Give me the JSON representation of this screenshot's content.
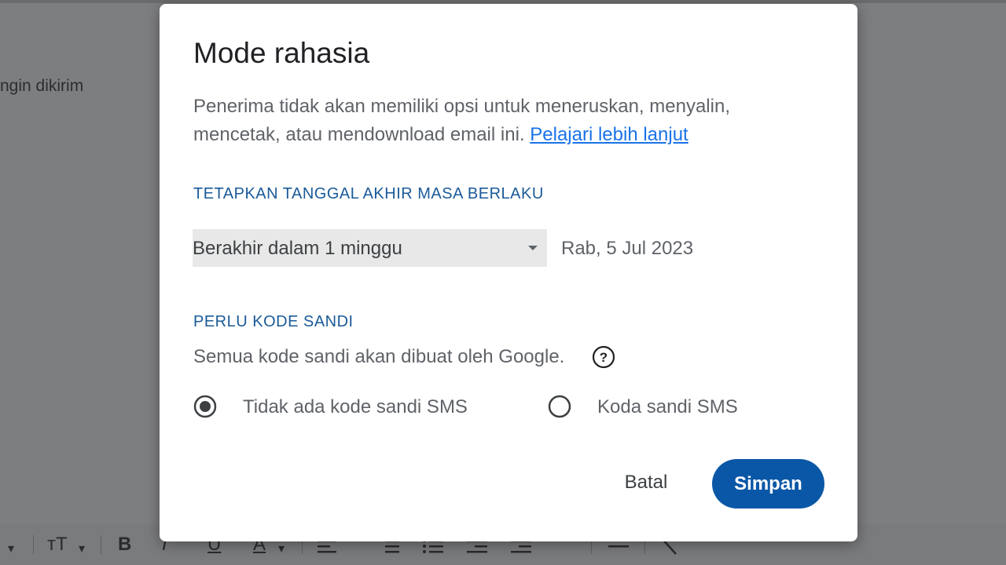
{
  "background": {
    "compose_text": "ngin dikirim",
    "toolbar": {
      "font_size_label": "тT",
      "bold": "B",
      "italic": "I",
      "underline": "U",
      "text_color": "A",
      "quote": "❞"
    }
  },
  "dialog": {
    "title": "Mode rahasia",
    "description": "Penerima tidak akan memiliki opsi untuk meneruskan, menyalin, mencetak, atau mendownload email ini.",
    "learn_more": "Pelajari lebih lanjut",
    "expiry": {
      "label": "TETAPKAN TANGGAL AKHIR MASA BERLAKU",
      "selected": "Berakhir dalam 1 minggu",
      "date": "Rab, 5 Jul 2023"
    },
    "passcode": {
      "label": "PERLU KODE SANDI",
      "note": "Semua kode sandi akan dibuat oleh Google.",
      "options": [
        {
          "label": "Tidak ada kode sandi SMS",
          "selected": true
        },
        {
          "label": "Koda sandi SMS",
          "selected": false
        }
      ]
    },
    "buttons": {
      "cancel": "Batal",
      "save": "Simpan"
    }
  },
  "colors": {
    "accent": "#0b57a7",
    "link": "#1a73e8",
    "section_label": "#1a5a99"
  }
}
